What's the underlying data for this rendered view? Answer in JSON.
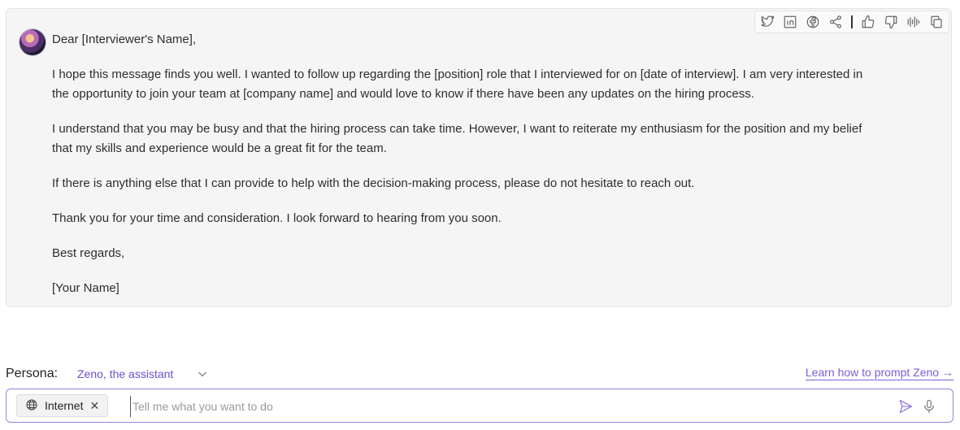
{
  "message": {
    "avatar": "assistant-avatar",
    "paragraphs": [
      "Dear [Interviewer's Name],",
      "I hope this message finds you well. I wanted to follow up regarding the [position] role that I interviewed for on [date of interview]. I am very interested in the opportunity to join your team at [company name] and would love to know if there have been any updates on the hiring process.",
      "I understand that you may be busy and that the hiring process can take time. However, I want to reiterate my enthusiasm for the position and my belief that my skills and experience would be a great fit for the team.",
      "If there is anything else that I can provide to help with the decision-making process, please do not hesitate to reach out.",
      "Thank you for your time and consideration. I look forward to hearing from you soon.",
      "Best regards,",
      "[Your Name]"
    ]
  },
  "toolbar": {
    "icons": [
      "twitter-icon",
      "linkedin-icon",
      "facebook-icon",
      "share-icon",
      "thumbs-up-icon",
      "thumbs-down-icon",
      "audio-wave-icon",
      "copy-icon"
    ]
  },
  "persona": {
    "label": "Persona:",
    "value": "Zeno, the assistant",
    "learn_link": "Learn how to prompt Zeno →"
  },
  "input": {
    "chip_label": "Internet",
    "chip_icon": "globe-icon",
    "placeholder": "Tell me what you want to do",
    "value": ""
  },
  "colors": {
    "accent": "#7b5fd6",
    "card_bg": "#f5f5f6"
  }
}
